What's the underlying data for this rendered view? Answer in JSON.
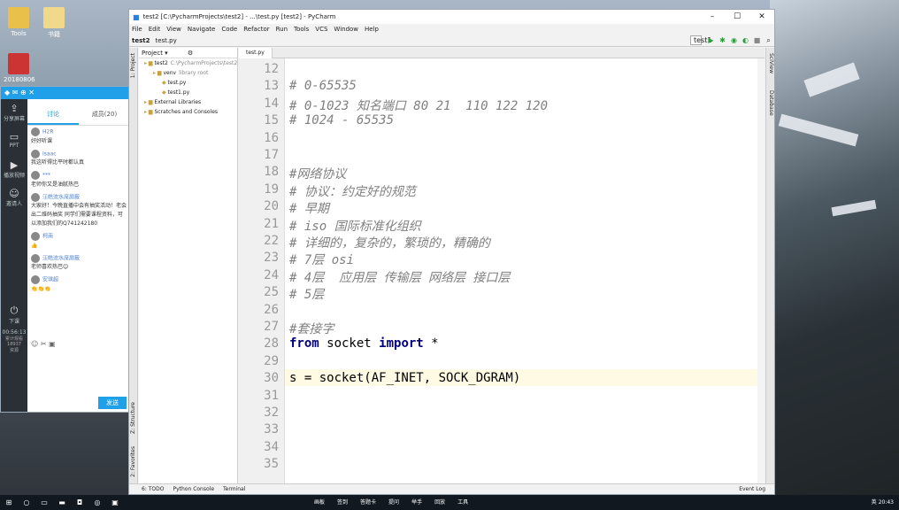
{
  "desktop": {
    "icons": [
      {
        "label": "Tools"
      },
      {
        "label": "书籍"
      },
      {
        "label": "20180806"
      }
    ]
  },
  "qq": {
    "side": [
      {
        "label": "分享屏幕",
        "glyph": "⇪"
      },
      {
        "label": "PPT",
        "glyph": "▭"
      },
      {
        "label": "播放视频",
        "glyph": "▶"
      },
      {
        "label": "邀请人",
        "glyph": "☺"
      },
      {
        "label": "下课",
        "glyph": "⏻"
      }
    ],
    "timer": "00:56:13",
    "stats": "累计观看\n18937\n资源",
    "tab_discuss": "讨论",
    "tab_members": "成员(20)",
    "messages": [
      {
        "name": "H2R",
        "text": "好好听课"
      },
      {
        "name": "Isaac",
        "text": "我这听得比平时都认真"
      },
      {
        "name": "***",
        "text": "老师你又是油腻热巴"
      },
      {
        "name": "汪皓流水席屏蔽",
        "text": "大家好！今晚直播中会有抽奖活动！老会出二维码抽奖 同学们需要课程资料，可以添加我们的Q741242180"
      },
      {
        "name": "柯南",
        "text": "👍"
      },
      {
        "name": "汪皓流水席屏蔽",
        "text": "老师喜欢热巴😊"
      },
      {
        "name": "安琪超",
        "text": "👏👏👏"
      }
    ],
    "send": "发送"
  },
  "pycharm": {
    "title": "test2 [C:\\PycharmProjects\\test2] - ...\\test.py [test2] - PyCharm",
    "menu": [
      "File",
      "Edit",
      "View",
      "Navigate",
      "Code",
      "Refactor",
      "Run",
      "Tools",
      "VCS",
      "Window",
      "Help"
    ],
    "crumbs": [
      "test2",
      "test.py"
    ],
    "run_config": "test1",
    "project_label": "Project",
    "tree": [
      {
        "text": "test2",
        "hint": "C:\\PycharmProjects\\test2",
        "indent": 0
      },
      {
        "text": "venv",
        "hint": "library root",
        "indent": 1
      },
      {
        "text": "test.py",
        "hint": "",
        "indent": 2
      },
      {
        "text": "test1.py",
        "hint": "",
        "indent": 2
      },
      {
        "text": "External Libraries",
        "hint": "",
        "indent": 0
      },
      {
        "text": "Scratches and Consoles",
        "hint": "",
        "indent": 0
      }
    ],
    "tab": "test.py",
    "left_tools": [
      "1: Project",
      "Z: Structure",
      "2: Favorites"
    ],
    "right_tools": [
      "SciView",
      "Database"
    ],
    "code": [
      {
        "n": "12",
        "t": "",
        "c": ""
      },
      {
        "n": "13",
        "t": "# 0-65535",
        "c": "cm"
      },
      {
        "n": "14",
        "t": "# 0-1023 知名端口 80 21  110 122 120",
        "c": "cm"
      },
      {
        "n": "15",
        "t": "# 1024 - 65535",
        "c": "cm"
      },
      {
        "n": "16",
        "t": "",
        "c": ""
      },
      {
        "n": "17",
        "t": "",
        "c": ""
      },
      {
        "n": "18",
        "t": "#网络协议",
        "c": "cm"
      },
      {
        "n": "19",
        "t": "# 协议：约定好的规范",
        "c": "cm"
      },
      {
        "n": "20",
        "t": "# 早期",
        "c": "cm"
      },
      {
        "n": "21",
        "t": "# iso 国际标准化组织",
        "c": "cm"
      },
      {
        "n": "22",
        "t": "# 详细的，复杂的，繁琐的，精确的",
        "c": "cm"
      },
      {
        "n": "23",
        "t": "# 7层 osi",
        "c": "cm"
      },
      {
        "n": "24",
        "t": "# 4层  应用层 传输层 网络层 接口层",
        "c": "cm"
      },
      {
        "n": "25",
        "t": "# 5层",
        "c": "cm"
      },
      {
        "n": "26",
        "t": "",
        "c": ""
      },
      {
        "n": "27",
        "t": "#套接字",
        "c": "cm"
      },
      {
        "n": "28",
        "t": "from socket import *",
        "c": "imp"
      },
      {
        "n": "29",
        "t": "",
        "c": ""
      },
      {
        "n": "30",
        "t": "s = socket(AF_INET, SOCK_DGRAM)",
        "c": ""
      },
      {
        "n": "31",
        "t": "",
        "c": ""
      },
      {
        "n": "32",
        "t": "",
        "c": ""
      },
      {
        "n": "33",
        "t": "",
        "c": ""
      },
      {
        "n": "34",
        "t": "",
        "c": ""
      },
      {
        "n": "35",
        "t": "",
        "c": ""
      }
    ],
    "bottom": [
      "6: TODO",
      "Python Console",
      "Terminal"
    ],
    "event_log": "Event Log"
  },
  "taskbar": {
    "tray": [
      "画板",
      "签到",
      "答题卡",
      "提问",
      "举手",
      "回放",
      "工具"
    ],
    "time": "20:43",
    "lang": "英"
  }
}
